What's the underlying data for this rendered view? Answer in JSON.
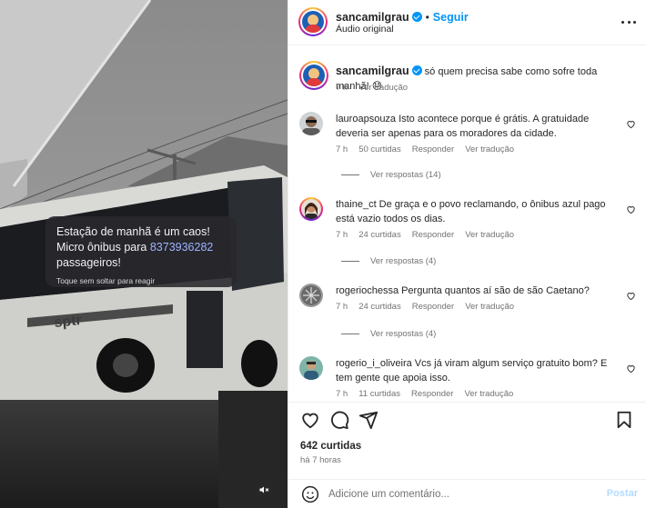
{
  "post": {
    "author": "sancamilgrau",
    "follow_label": "Seguir",
    "audio": "Áudio original",
    "caption": "só quem precisa sabe como sofre toda manhã! 😓",
    "caption_time": "7 h",
    "caption_translate": "Ver tradução"
  },
  "story_card": {
    "line1": "Estação de manhã é um caos!",
    "line2_prefix": "Micro ônibus para",
    "line2_number": "8373936282",
    "line3": "passageiros!",
    "hint": "Toque sem soltar para reagir"
  },
  "comments": [
    {
      "user": "lauroapsouza",
      "text": "Isto acontece porque é grátis. A gratuidade deveria ser apenas para os moradores da cidade.",
      "time": "7 h",
      "likes": "50 curtidas",
      "reply": "Responder",
      "translate": "Ver tradução",
      "replies": "Ver respostas (14)"
    },
    {
      "user": "thaine_ct",
      "text": "De graça e o povo reclamando, o ônibus azul pago está vazio todos os dias.",
      "time": "7 h",
      "likes": "24 curtidas",
      "reply": "Responder",
      "translate": "Ver tradução",
      "replies": "Ver respostas (4)"
    },
    {
      "user": "rogeriochessa",
      "text": "Pergunta quantos aí são de são Caetano?",
      "time": "7 h",
      "likes": "24 curtidas",
      "reply": "Responder",
      "translate": "Ver tradução",
      "replies": "Ver respostas (4)"
    },
    {
      "user": "rogerio_i_oliveira",
      "text": "Vcs já viram algum serviço gratuito bom? E tem gente que apoia isso.",
      "time": "7 h",
      "likes": "11 curtidas",
      "reply": "Responder",
      "translate": "Ver tradução"
    }
  ],
  "footer": {
    "likes": "642 curtidas",
    "time_ago": "há 7 horas",
    "comment_placeholder": "Adicione um comentário...",
    "post_label": "Postar"
  },
  "colors": {
    "accent": "#0095f6",
    "post_disabled": "#b3dbff",
    "secondary_text": "#737373"
  },
  "icons": [
    "verified-badge-icon",
    "more-options-icon",
    "heart-icon",
    "comment-icon",
    "share-icon",
    "bookmark-icon",
    "emoji-icon",
    "mute-icon"
  ]
}
